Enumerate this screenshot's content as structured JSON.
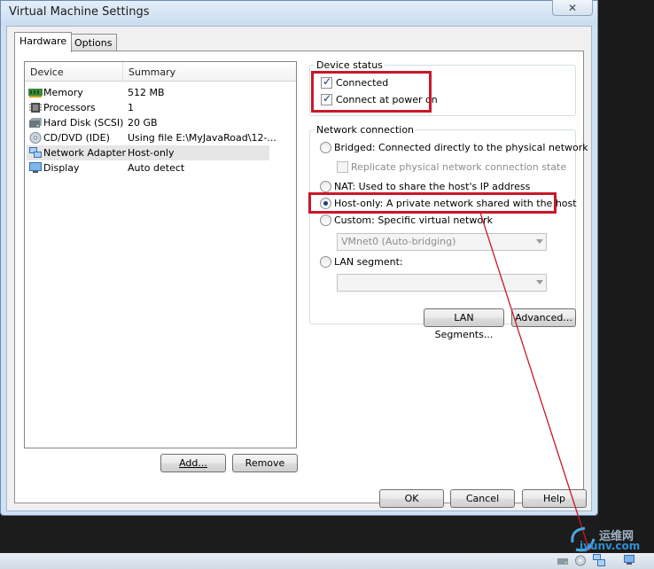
{
  "window": {
    "title": "Virtual Machine Settings",
    "close_glyph": "✕"
  },
  "tabs": [
    {
      "label": "Hardware"
    },
    {
      "label": "Options"
    }
  ],
  "device_list": {
    "headers": {
      "device": "Device",
      "summary": "Summary"
    },
    "rows": [
      {
        "device": "Memory",
        "summary": "512 MB",
        "icon": "memory-icon"
      },
      {
        "device": "Processors",
        "summary": "1",
        "icon": "processor-icon"
      },
      {
        "device": "Hard Disk (SCSI)",
        "summary": "20 GB",
        "icon": "hard-disk-icon"
      },
      {
        "device": "CD/DVD (IDE)",
        "summary": "Using file E:\\MyJavaRoad\\12-...",
        "icon": "cd-dvd-icon"
      },
      {
        "device": "Network Adapter",
        "summary": "Host-only",
        "icon": "network-adapter-icon",
        "selected": true
      },
      {
        "device": "Display",
        "summary": "Auto detect",
        "icon": "display-icon"
      }
    ]
  },
  "device_status": {
    "label": "Device status",
    "connected": {
      "label": "Connected",
      "checked": true
    },
    "connect_at_power_on": {
      "label": "Connect at power on",
      "checked": true
    }
  },
  "network_connection": {
    "label": "Network connection",
    "bridged": {
      "label": "Bridged: Connected directly to the physical network"
    },
    "replicate": {
      "label": "Replicate physical network connection state",
      "disabled": true
    },
    "nat": {
      "label": "NAT: Used to share the host's IP address"
    },
    "host_only": {
      "label": "Host-only: A private network shared with the host",
      "selected": true
    },
    "custom": {
      "label": "Custom: Specific virtual network"
    },
    "vmnet_select": {
      "value": "VMnet0 (Auto-bridging)"
    },
    "lan_segment": {
      "label": "LAN segment:"
    },
    "lan_select": {
      "value": ""
    }
  },
  "buttons": {
    "lan_segments": "LAN Segments...",
    "advanced": "Advanced...",
    "add": "Add...",
    "remove": "Remove",
    "ok": "OK",
    "cancel": "Cancel",
    "help": "Help"
  },
  "watermark": {
    "text": "运维网",
    "url": "iyunv.com"
  },
  "colors": {
    "highlight": "#c8182a",
    "selected_radio": "#1d3c7a"
  }
}
